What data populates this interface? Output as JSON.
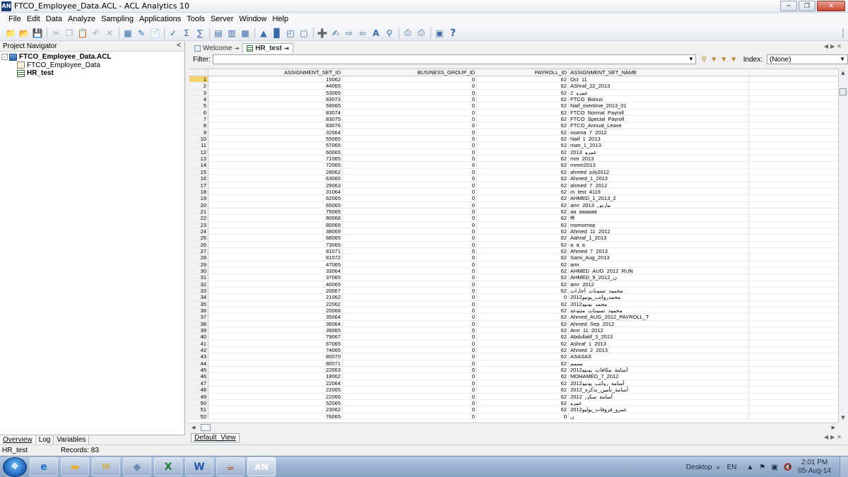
{
  "window": {
    "app_icon": "AN",
    "title": "FTCO_Employee_Data.ACL - ACL Analytics 10"
  },
  "menu": [
    "File",
    "Edit",
    "Data",
    "Analyze",
    "Sampling",
    "Applications",
    "Tools",
    "Server",
    "Window",
    "Help"
  ],
  "project_navigator": {
    "title": "Project Navigator",
    "collapse": "<",
    "items": [
      {
        "label": "FTCO_Employee_Data.ACL",
        "expander": "-"
      },
      {
        "label": "FTCO_Employee_Data"
      },
      {
        "label": "HR_test"
      }
    ],
    "tabs": [
      "Overview",
      "Log",
      "Variables"
    ]
  },
  "doc_tabs": [
    {
      "label": "Welcome",
      "pin": "⇥"
    },
    {
      "label": "HR_test",
      "pin": "⇥"
    }
  ],
  "filter": {
    "label": "Filter:",
    "value": "",
    "index_label": "Index:",
    "index_value": "(None)"
  },
  "table": {
    "columns": [
      "ASSIGNMENT_SET_ID",
      "BUSINESS_GROUP_ID",
      "PAYROLL_ID",
      "ASSIGNMENT_SET_NAME"
    ],
    "rows": [
      [
        "1",
        "15062",
        "0",
        "62",
        "Oct_11"
      ],
      [
        "2",
        "44065",
        "0",
        "62",
        "AShraf_22_2013"
      ],
      [
        "3",
        "53065",
        "0",
        "62",
        "عمرو_2"
      ],
      [
        "4",
        "83073",
        "0",
        "62",
        "FTCO_Bonus"
      ],
      [
        "5",
        "59065",
        "0",
        "62",
        "Naif_overtime_2013_01"
      ],
      [
        "6",
        "83074",
        "0",
        "62",
        "FTCO_Normal_Payroll"
      ],
      [
        "7",
        "83075",
        "0",
        "62",
        "FTCO_Special_Payroll"
      ],
      [
        "8",
        "83076",
        "0",
        "62",
        "FTCO_Annual_Leave"
      ],
      [
        "9",
        "32064",
        "0",
        "62",
        "osama_7_2012"
      ],
      [
        "10",
        "55065",
        "0",
        "62",
        "Naif_1_2013"
      ],
      [
        "11",
        "57065",
        "0",
        "62",
        "man_1_2013"
      ],
      [
        "12",
        "60065",
        "0",
        "62",
        "عمرو_2013"
      ],
      [
        "13",
        "71065",
        "0",
        "62",
        "mm_2013"
      ],
      [
        "14",
        "72065",
        "0",
        "62",
        "mmm2013"
      ],
      [
        "15",
        "28062",
        "0",
        "62",
        "ahmed_july2012"
      ],
      [
        "16",
        "63065",
        "0",
        "62",
        "Ahmed_1_2013"
      ],
      [
        "17",
        "29063",
        "0",
        "62",
        "ahmed_7_2012"
      ],
      [
        "18",
        "31064",
        "0",
        "62",
        "m_test_4119"
      ],
      [
        "19",
        "62065",
        "0",
        "62",
        "AHMED_1_2013_2"
      ],
      [
        "20",
        "65065",
        "0",
        "62",
        "amr_2013_مارس"
      ],
      [
        "21",
        "75065",
        "0",
        "62",
        "aa_aaaaaa"
      ],
      [
        "22",
        "80068",
        "0",
        "62",
        "fff"
      ],
      [
        "23",
        "80069",
        "0",
        "62",
        "momomop"
      ],
      [
        "24",
        "38069",
        "0",
        "62",
        "Ahmed_11_2012"
      ],
      [
        "25",
        "68065",
        "0",
        "62",
        "Aahraf_1_2013"
      ],
      [
        "26",
        "73065",
        "0",
        "62",
        "a_a_a"
      ],
      [
        "27",
        "81071",
        "0",
        "62",
        "Ahmed_7_2013"
      ],
      [
        "28",
        "81072",
        "0",
        "62",
        "Sami_Aug_2013"
      ],
      [
        "29",
        "47065",
        "0",
        "62",
        "amr"
      ],
      [
        "30",
        "33064",
        "0",
        "62",
        "AHMED_AUG_2012_RUN"
      ],
      [
        "31",
        "37065",
        "0",
        "62",
        "AHMED_9_2012_ن"
      ],
      [
        "32",
        "40065",
        "0",
        "62",
        "amr_2012"
      ],
      [
        "33",
        "20067",
        "0",
        "62",
        "محمود_تسويات_أجازات"
      ],
      [
        "34",
        "21062",
        "0",
        "0",
        "محمدرواتب_يونيو2012"
      ],
      [
        "35",
        "22062",
        "0",
        "62",
        "محمد_يونيو2012"
      ],
      [
        "36",
        "20068",
        "0",
        "62",
        "محمود_تسويات_متنوعة"
      ],
      [
        "37",
        "35064",
        "0",
        "62",
        "Ahmed_AUG_2012_PAYROLL_T"
      ],
      [
        "38",
        "36064",
        "0",
        "62",
        "Ahmed_Sep_2012"
      ],
      [
        "39",
        "39065",
        "0",
        "62",
        "Amr_11_2012"
      ],
      [
        "40",
        "79067",
        "0",
        "62",
        "Abdullatif_3_2013"
      ],
      [
        "41",
        "67065",
        "0",
        "62",
        "Ashraf_1_2013"
      ],
      [
        "42",
        "74065",
        "0",
        "62",
        "Ahmed_2_2013"
      ],
      [
        "43",
        "80070",
        "0",
        "62",
        "ASASAS"
      ],
      [
        "44",
        "80071",
        "0",
        "62",
        "مممم"
      ],
      [
        "45",
        "22063",
        "0",
        "62",
        "أسامة_مكافات_يونيو2012"
      ],
      [
        "46",
        "18062",
        "0",
        "62",
        "MOHAMED_7_2012"
      ],
      [
        "47",
        "22064",
        "0",
        "62",
        "أسامة_رواتب_يونيو2012"
      ],
      [
        "48",
        "22065",
        "0",
        "62",
        "أسامة_تأمين_تذكرة_2012"
      ],
      [
        "49",
        "22066",
        "0",
        "62",
        "أسامة_سكن_2012"
      ],
      [
        "50",
        "52065",
        "0",
        "62",
        "عمرو"
      ],
      [
        "51",
        "23062",
        "0",
        "62",
        "عمرو_فروقات_يوليو2012"
      ],
      [
        "52",
        "76065",
        "0",
        "0",
        "ن"
      ]
    ]
  },
  "view_tab": "Default_View",
  "status": {
    "table_name": "HR_test",
    "records": "Records: 83"
  },
  "taskbar": {
    "apps": [
      {
        "name": "internet-explorer",
        "glyph": "e"
      },
      {
        "name": "file-explorer",
        "glyph": "▬"
      },
      {
        "name": "outlook",
        "glyph": "✉"
      },
      {
        "name": "file-app",
        "glyph": "◆"
      },
      {
        "name": "excel",
        "glyph": "X"
      },
      {
        "name": "word",
        "glyph": "W"
      },
      {
        "name": "java",
        "glyph": "☕"
      },
      {
        "name": "acl",
        "glyph": "AN"
      }
    ],
    "desktop_label": "Desktop",
    "chevron": "»",
    "language": "EN",
    "time": "2:01 PM",
    "date": "05-Aug-14"
  }
}
